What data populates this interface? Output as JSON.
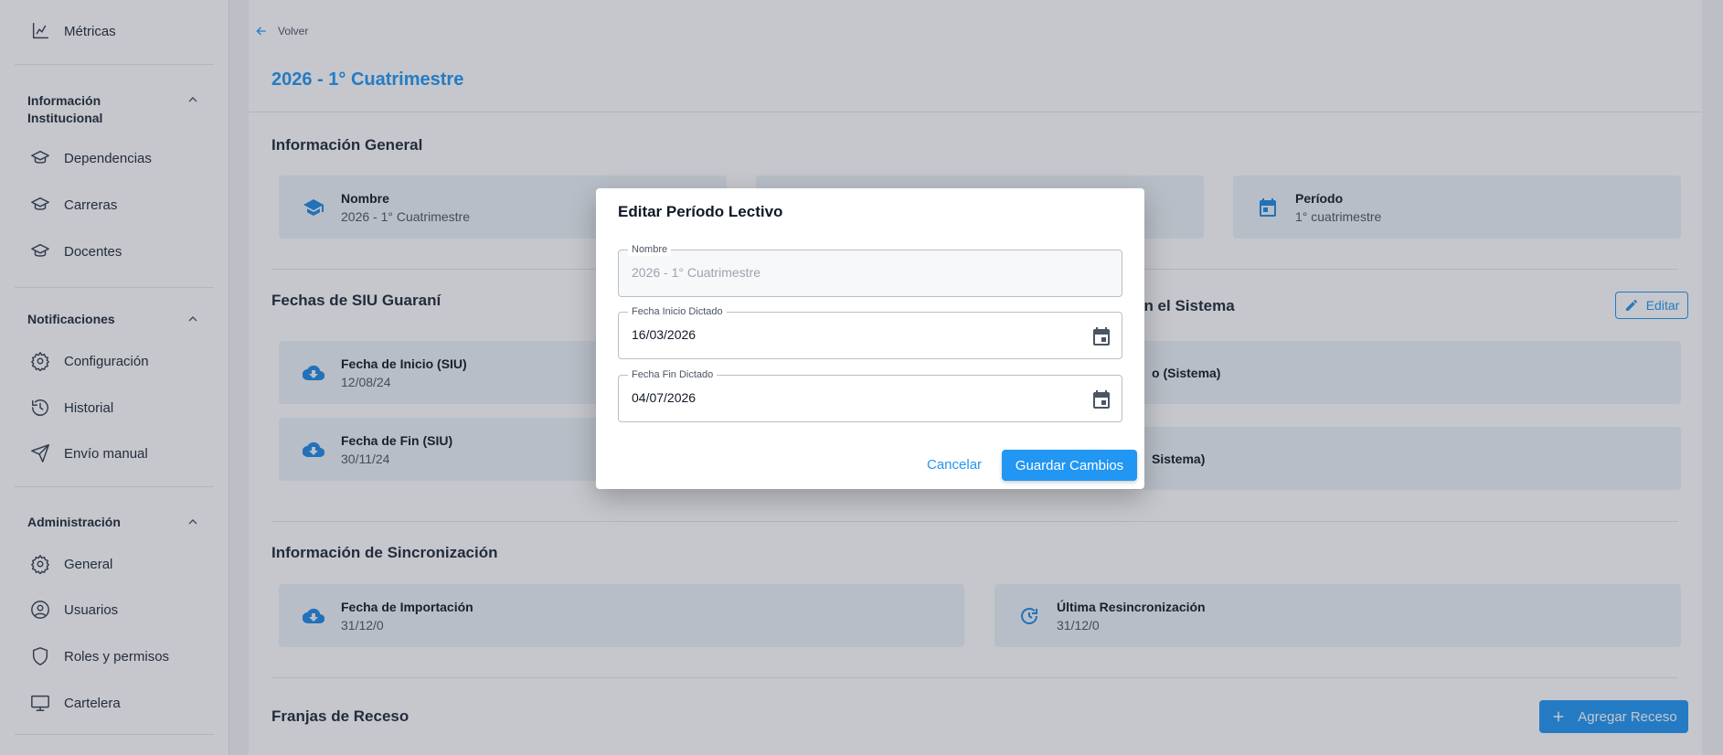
{
  "sidebar": {
    "metricas": "Métricas",
    "sections": {
      "institucional": "Información Institucional",
      "notificaciones": "Notificaciones",
      "administracion": "Administración"
    },
    "items": {
      "dependencias": "Dependencias",
      "carreras": "Carreras",
      "docentes": "Docentes",
      "configuracion": "Configuración",
      "historial": "Historial",
      "envio_manual": "Envío manual",
      "general": "General",
      "usuarios": "Usuarios",
      "roles": "Roles y permisos",
      "cartelera": "Cartelera"
    }
  },
  "main": {
    "back_label": "Volver",
    "page_title": "2026 - 1° Cuatrimestre",
    "info_general": {
      "title": "Información General",
      "nombre_label": "Nombre",
      "nombre_value": "2026 - 1° Cuatrimestre",
      "periodo_label": "Período",
      "periodo_value": "1° cuatrimestre"
    },
    "siu": {
      "title": "Fechas de SIU Guaraní",
      "inicio_label": "Fecha de Inicio (SIU)",
      "inicio_value": "12/08/24",
      "fin_label": "Fecha de Fin (SIU)",
      "fin_value": "30/11/24"
    },
    "sistema": {
      "title_partial": "en el Sistema",
      "edit_label": "Editar",
      "inicio_partial": "o (Sistema)",
      "fin_partial": "Sistema)"
    },
    "sync": {
      "title": "Información de Sincronización",
      "import_label": "Fecha de Importación",
      "import_value": "31/12/0",
      "resync_label": "Última Resincronización",
      "resync_value": "31/12/0"
    },
    "receso": {
      "title": "Franjas de Receso",
      "add_label": "Agregar Receso"
    }
  },
  "modal": {
    "title": "Editar Período Lectivo",
    "nombre_label": "Nombre",
    "nombre_value": "2026 - 1° Cuatrimestre",
    "inicio_label": "Fecha Inicio Dictado",
    "inicio_value": "16/03/2026",
    "fin_label": "Fecha Fin Dictado",
    "fin_value": "04/07/2026",
    "cancel_label": "Cancelar",
    "save_label": "Guardar Cambios"
  },
  "colors": {
    "accent": "#2196f3",
    "card_bg": "#eef3f9",
    "overlay": "rgba(45,55,72,0.28)"
  }
}
